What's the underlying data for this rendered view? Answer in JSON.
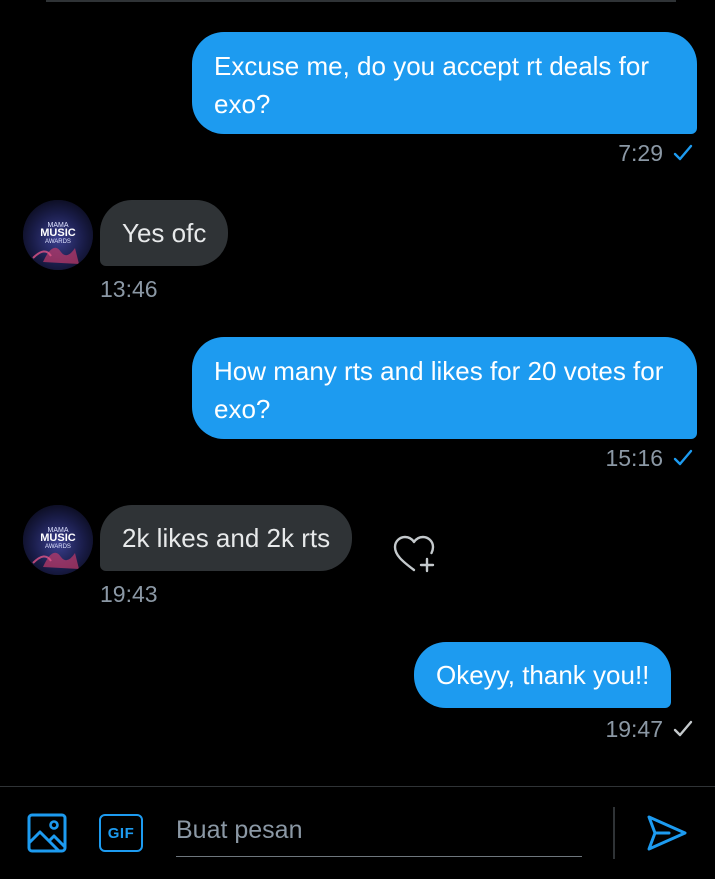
{
  "conversation": {
    "messages": [
      {
        "direction": "outgoing",
        "text": "Excuse me, do you accept rt deals for exo?",
        "time": "7:29",
        "status": "seen"
      },
      {
        "direction": "incoming",
        "text": "Yes ofc",
        "time": "13:46"
      },
      {
        "direction": "outgoing",
        "text": "How many rts and likes for 20 votes for exo?",
        "time": "15:16",
        "status": "seen"
      },
      {
        "direction": "incoming",
        "text": "2k likes and 2k rts",
        "time": "19:43"
      },
      {
        "direction": "outgoing",
        "text": "Okeyy, thank you!!",
        "time": "19:47",
        "status": "sent"
      }
    ]
  },
  "avatar": {
    "text_line1": "MUSIC",
    "text_line2": "AWARDS"
  },
  "reaction": {
    "icon": "heart-plus-icon"
  },
  "composer": {
    "placeholder": "Buat pesan",
    "gif_label": "GIF",
    "image_icon": "image-icon",
    "send_icon": "send-icon"
  },
  "colors": {
    "accent": "#1d9bf0",
    "background": "#000000",
    "incoming_bubble": "#2f3336",
    "timestamp": "#8b98a5",
    "seen_check": "#1d9bf0",
    "sent_check": "#c4c9cc"
  }
}
